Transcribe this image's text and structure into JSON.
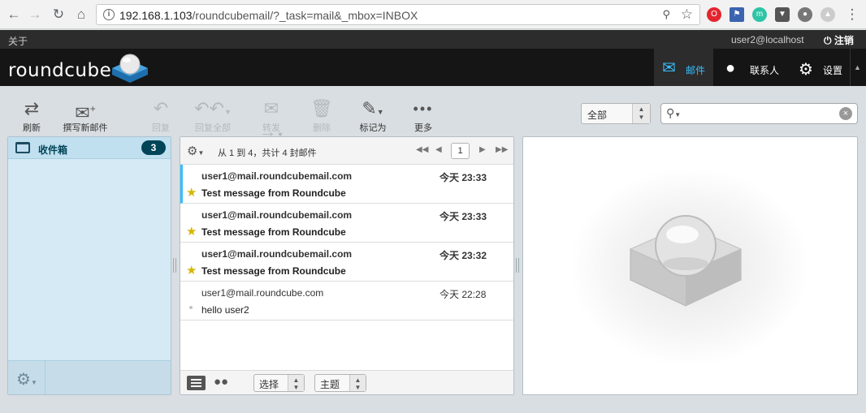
{
  "browser": {
    "url_host": "192.168.1.103",
    "url_path": "/roundcubemail/?_task=mail&_mbox=INBOX"
  },
  "topline": {
    "about": "关于",
    "user": "user2@localhost",
    "logout": "注销"
  },
  "header": {
    "logo_text": "roundcube",
    "tasks": [
      {
        "label": "邮件",
        "icon": "envelope-icon",
        "active": true
      },
      {
        "label": "联系人",
        "icon": "person-icon",
        "active": false
      },
      {
        "label": "设置",
        "icon": "gear-icon",
        "active": false
      }
    ]
  },
  "toolbar": {
    "refresh": "刷新",
    "compose": "撰写新邮件",
    "reply": "回复",
    "reply_all": "回复全部",
    "forward": "转发",
    "delete": "删除",
    "mark": "标记为",
    "more": "更多",
    "filter_value": "全部",
    "search_value": ""
  },
  "folders": {
    "items": [
      {
        "name": "收件箱",
        "unread": "3"
      }
    ]
  },
  "messagelist": {
    "count_text": "从 1 到 4，共计 4 封邮件",
    "page": "1",
    "messages": [
      {
        "from": "user1@mail.roundcubemail.com",
        "date": "今天 23:33",
        "subject": "Test message from Roundcube",
        "unread": true,
        "flagged": true
      },
      {
        "from": "user1@mail.roundcubemail.com",
        "date": "今天 23:33",
        "subject": "Test message from Roundcube",
        "unread": true,
        "flagged": true
      },
      {
        "from": "user1@mail.roundcubemail.com",
        "date": "今天 23:32",
        "subject": "Test message from Roundcube",
        "unread": true,
        "flagged": true
      },
      {
        "from": "user1@mail.roundcube.com",
        "date": "今天 22:28",
        "subject": "hello user2",
        "unread": false,
        "flagged": false
      }
    ],
    "footer": {
      "select_label": "选择",
      "threads_label": "主题"
    }
  },
  "colors": {
    "accent": "#37beff",
    "header_bg": "#151515",
    "folder_badge": "#004458",
    "flag": "#d6b600"
  }
}
